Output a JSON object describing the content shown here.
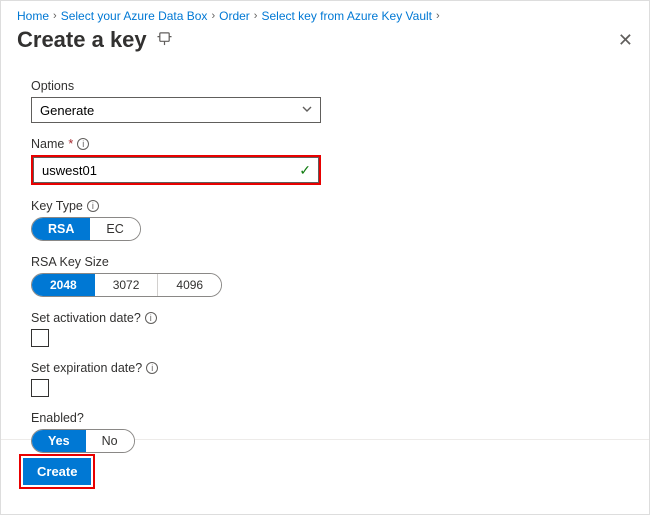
{
  "breadcrumb": {
    "items": [
      {
        "label": "Home"
      },
      {
        "label": "Select your Azure Data Box"
      },
      {
        "label": "Order"
      },
      {
        "label": "Select key from Azure Key Vault"
      }
    ]
  },
  "title": "Create a key",
  "form": {
    "options": {
      "label": "Options",
      "value": "Generate"
    },
    "name": {
      "label": "Name",
      "value": "uswest01"
    },
    "key_type": {
      "label": "Key Type",
      "options": [
        "RSA",
        "EC"
      ],
      "selected": "RSA"
    },
    "rsa_key_size": {
      "label": "RSA Key Size",
      "options": [
        "2048",
        "3072",
        "4096"
      ],
      "selected": "2048"
    },
    "activation": {
      "label": "Set activation date?"
    },
    "expiration": {
      "label": "Set expiration date?"
    },
    "enabled": {
      "label": "Enabled?",
      "options": [
        "Yes",
        "No"
      ],
      "selected": "Yes"
    }
  },
  "footer": {
    "create_label": "Create"
  }
}
